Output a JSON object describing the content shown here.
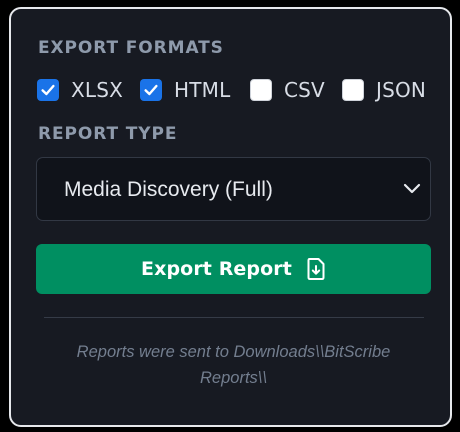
{
  "export_formats": {
    "heading": "EXPORT FORMATS",
    "options": [
      {
        "label": "XLSX",
        "checked": true
      },
      {
        "label": "HTML",
        "checked": true
      },
      {
        "label": "CSV",
        "checked": false
      },
      {
        "label": "JSON",
        "checked": false
      }
    ]
  },
  "report_type": {
    "heading": "REPORT TYPE",
    "selected": "Media Discovery (Full)",
    "icon": "chevron-down-icon"
  },
  "export_button": {
    "label": "Export Report",
    "icon": "file-download-icon"
  },
  "status_message": "Reports were sent to Downloads\\\\BitScribe Reports\\\\",
  "colors": {
    "accent": "#008f61",
    "checkbox_checked": "#1a73e8",
    "panel_bg": "#171a22",
    "panel_border": "#e6e8ec"
  }
}
